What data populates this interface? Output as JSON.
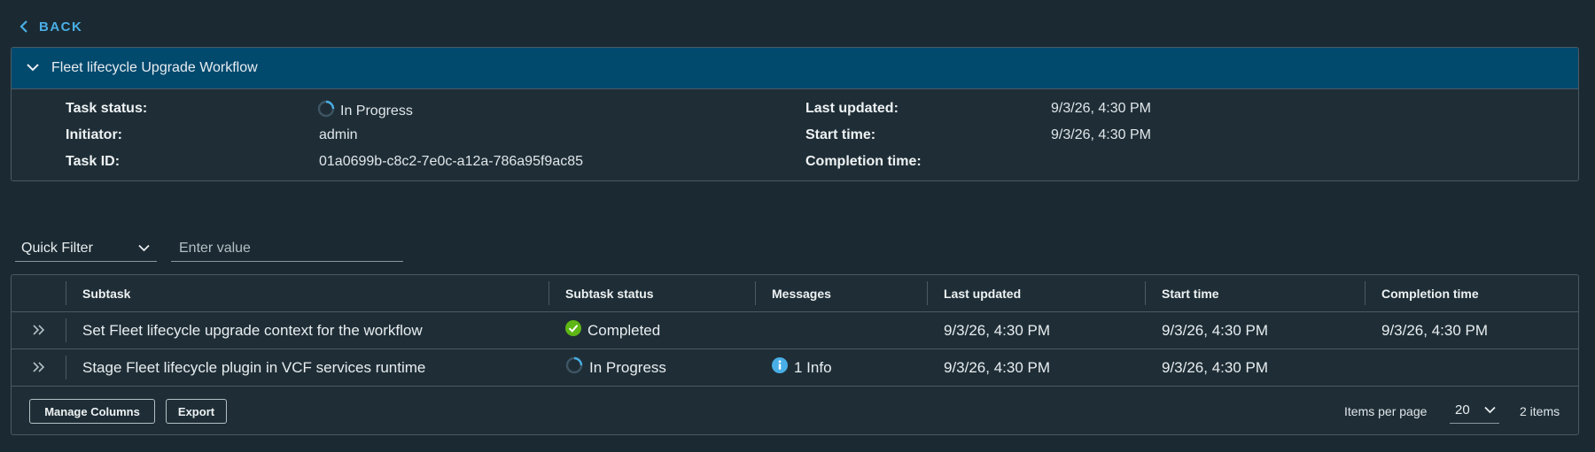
{
  "back_label": "BACK",
  "workflow": {
    "title": "Fleet lifecycle Upgrade Workflow",
    "fields_left": [
      {
        "label": "Task status:",
        "value": "In Progress",
        "icon": "spinner-icon"
      },
      {
        "label": "Initiator:",
        "value": "admin"
      },
      {
        "label": "Task ID:",
        "value": "01a0699b-c8c2-7e0c-a12a-786a95f9ac85"
      }
    ],
    "fields_right": [
      {
        "label": "Last updated:",
        "value": "9/3/26, 4:30 PM"
      },
      {
        "label": "Start time:",
        "value": "9/3/26, 4:30 PM"
      },
      {
        "label": "Completion time:",
        "value": ""
      }
    ]
  },
  "filter": {
    "select_value": "Quick Filter",
    "input_placeholder": "Enter value"
  },
  "table": {
    "columns": [
      "Subtask",
      "Subtask status",
      "Messages",
      "Last updated",
      "Start time",
      "Completion time"
    ],
    "rows": [
      {
        "subtask": "Set Fleet lifecycle upgrade context for the workflow",
        "status": "Completed",
        "status_icon": "check-circle-icon",
        "messages": "",
        "last_updated": "9/3/26, 4:30 PM",
        "start_time": "9/3/26, 4:30 PM",
        "completion_time": "9/3/26, 4:30 PM"
      },
      {
        "subtask": "Stage Fleet lifecycle plugin in VCF services runtime",
        "status": "In Progress",
        "status_icon": "spinner-icon",
        "messages": "1 Info",
        "messages_icon": "info-icon",
        "last_updated": "9/3/26, 4:30 PM",
        "start_time": "9/3/26, 4:30 PM",
        "completion_time": ""
      }
    ]
  },
  "footer": {
    "manage_columns_label": "Manage Columns",
    "export_label": "Export",
    "items_per_page_label": "Items per page",
    "items_per_page_value": "20",
    "item_count": "2 items"
  },
  "colors": {
    "background": "#1b2a32",
    "header_blue": "#02496e",
    "link_blue": "#49aee6",
    "success_green": "#5eb715",
    "info_blue": "#49aee6"
  }
}
